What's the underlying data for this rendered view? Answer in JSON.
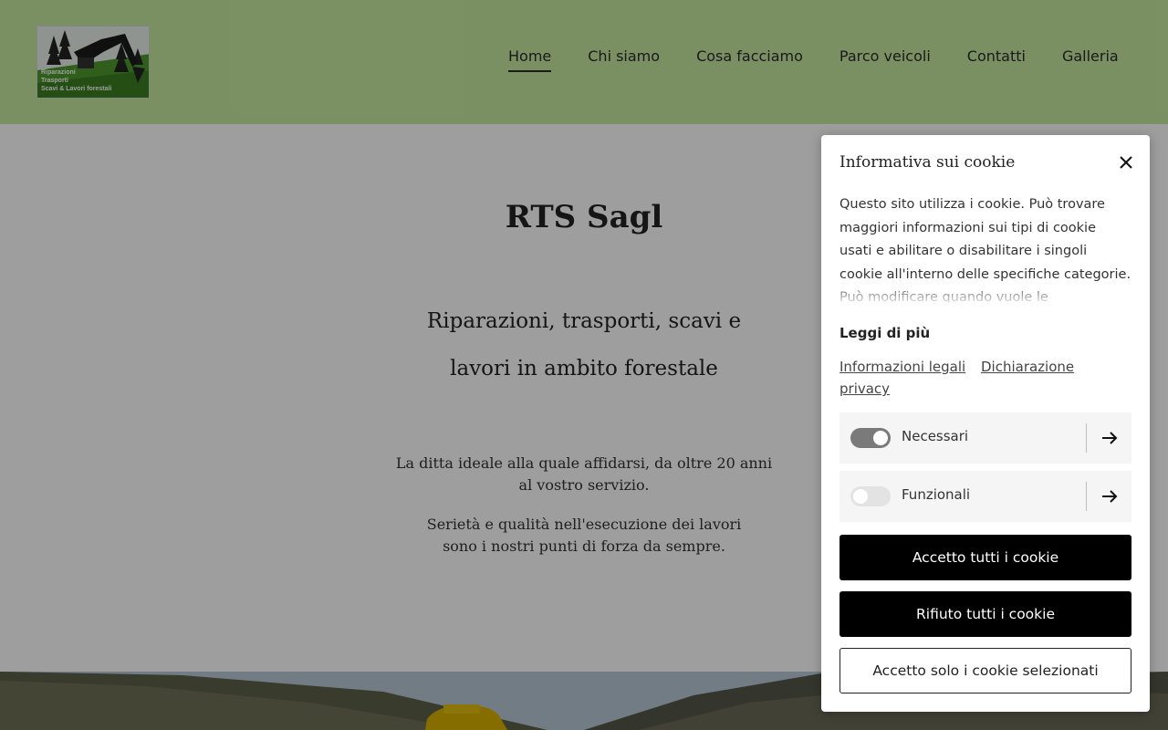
{
  "header": {
    "logo_lines": [
      "Riparazioni",
      "Trasporti",
      "Scavi & Lavori forestali"
    ],
    "nav": [
      {
        "label": "Home",
        "active": true
      },
      {
        "label": "Chi siamo"
      },
      {
        "label": "Cosa facciamo"
      },
      {
        "label": "Parco veicoli"
      },
      {
        "label": "Contatti"
      },
      {
        "label": "Galleria"
      }
    ]
  },
  "main": {
    "title": "RTS Sagl",
    "tagline": [
      "Riparazioni, trasporti, scavi e",
      "lavori in ambito forestale"
    ],
    "intro": [
      "La ditta ideale alla quale affidarsi, da oltre 20 anni",
      "al vostro servizio."
    ],
    "strengths": [
      "Serietà e qualità nell'esecuzione dei lavori",
      "sono i nostri punti di forza da sempre."
    ]
  },
  "cookie_dialog": {
    "title": "Informativa sui cookie",
    "text": "Questo sito utilizza i cookie. Può trovare maggiori informazioni sui tipi di cookie usati e abilitare o disabilitare i singoli cookie all'interno delle specifiche categorie. Può modificare quando vuole le",
    "read_more": "Leggi di più",
    "links": [
      "Informazioni legali",
      "Dichiarazione privacy"
    ],
    "categories": [
      {
        "label": "Necessari",
        "enabled": true
      },
      {
        "label": "Funzionali",
        "enabled": false
      }
    ],
    "buttons": {
      "accept_all": "Accetto tutti i cookie",
      "reject_all": "Rifiuto tutti i cookie",
      "accept_selected": "Accetto solo i cookie selezionati"
    }
  },
  "colors": {
    "header_bg": "#c6e8a0",
    "overlay": "rgba(0,0,0,0.38)",
    "button_primary": "#000000"
  },
  "icons": [
    "close-icon",
    "arrow-right-icon",
    "logo-image"
  ]
}
